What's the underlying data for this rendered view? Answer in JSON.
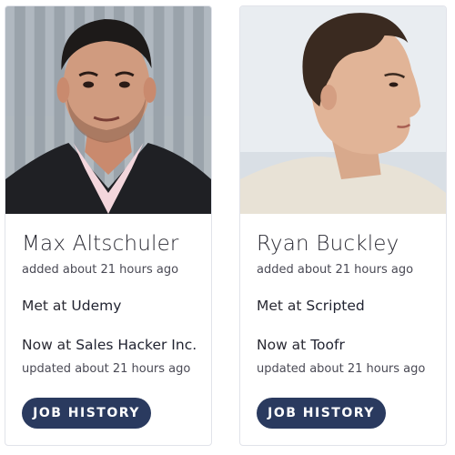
{
  "contacts": [
    {
      "name": "Max Altschuler",
      "added": "added about 21 hours ago",
      "met_prefix": "Met at ",
      "met_company": "Udemy",
      "now_prefix": "Now at ",
      "now_company": "Sales Hacker Inc.",
      "updated": "updated about 21 hours ago",
      "button_label": "JOB HISTORY"
    },
    {
      "name": "Ryan Buckley",
      "added": "added about 21 hours ago",
      "met_prefix": "Met at ",
      "met_company": "Scripted",
      "now_prefix": "Now at ",
      "now_company": "Toofr",
      "updated": "updated about 21 hours ago",
      "button_label": "JOB HISTORY"
    }
  ],
  "colors": {
    "button_bg": "#2a3a5f",
    "card_border": "#e1e3ea"
  }
}
